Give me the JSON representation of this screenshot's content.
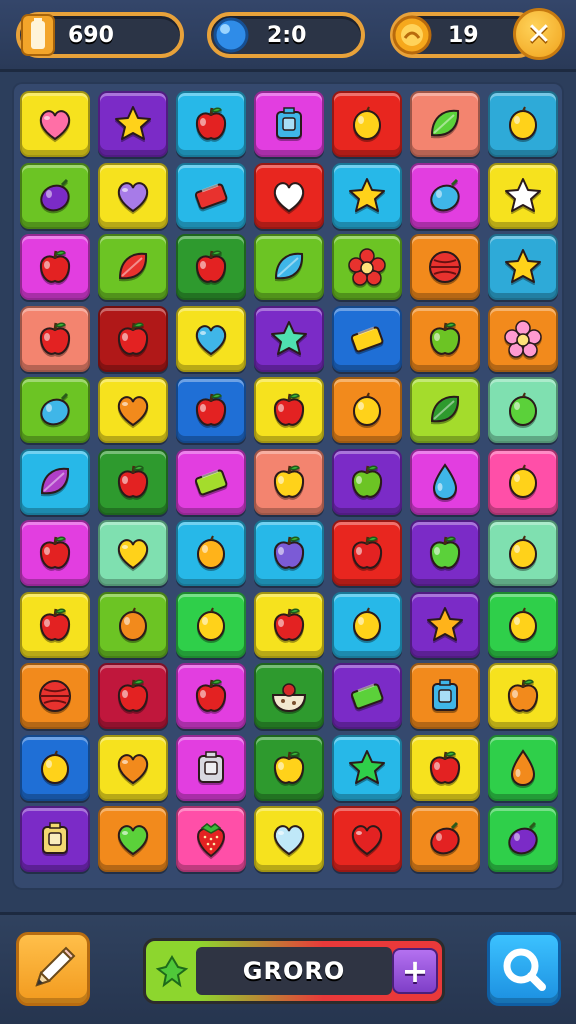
{
  "hud": {
    "score": "690",
    "timer": "2:0",
    "coins": "19",
    "score_icon": "battery-icon",
    "timer_icon": "blue-orb-icon",
    "coins_icon": "gold-coin-icon",
    "close_icon": "close-icon",
    "close_glyph": "✕"
  },
  "colors": {
    "yellow": "#f6e21e",
    "purple": "#7b2bc7",
    "cyan": "#27b8e8",
    "magenta": "#e23ee0",
    "red": "#e8261f",
    "salmon": "#f3846f",
    "teal": "#2eaad8",
    "green": "#6cc424",
    "pink": "#ff4fa8",
    "orange": "#f28a1c",
    "mint": "#7fe0b0",
    "darkgreen": "#2e9a2e",
    "blue": "#1f6fd6",
    "crimson": "#c0173c",
    "lime": "#a4dc2c",
    "darkred": "#b01818",
    "brightgreen": "#2fcf4a"
  },
  "board": {
    "rows": [
      [
        {
          "bg": "yellow",
          "icon": "heart",
          "c": "#ff6fa6"
        },
        {
          "bg": "purple",
          "icon": "star",
          "c": "#ffd21a"
        },
        {
          "bg": "cyan",
          "icon": "apple",
          "c": "#e32222"
        },
        {
          "bg": "magenta",
          "icon": "box",
          "c": "#3fb6e8"
        },
        {
          "bg": "red",
          "icon": "lemon",
          "c": "#ffd21a"
        },
        {
          "bg": "salmon",
          "icon": "leaf",
          "c": "#5bd13a"
        },
        {
          "bg": "teal",
          "icon": "lemon",
          "c": "#ffd21a"
        }
      ],
      [
        {
          "bg": "green",
          "icon": "plum",
          "c": "#7b2bc7"
        },
        {
          "bg": "yellow",
          "icon": "heart",
          "c": "#a77be8"
        },
        {
          "bg": "cyan",
          "icon": "candy",
          "c": "#e8322e"
        },
        {
          "bg": "red",
          "icon": "heart",
          "c": "#ffffff"
        },
        {
          "bg": "cyan",
          "icon": "star",
          "c": "#ffd21a"
        },
        {
          "bg": "magenta",
          "icon": "plum",
          "c": "#3fb6e8"
        },
        {
          "bg": "yellow",
          "icon": "star",
          "c": "#ffffff"
        }
      ],
      [
        {
          "bg": "magenta",
          "icon": "apple",
          "c": "#e32222"
        },
        {
          "bg": "green",
          "icon": "leaf",
          "c": "#e8322e"
        },
        {
          "bg": "darkgreen",
          "icon": "apple",
          "c": "#e32222"
        },
        {
          "bg": "green",
          "icon": "leaf",
          "c": "#3fb6e8"
        },
        {
          "bg": "green",
          "icon": "flower",
          "c": "#e8322e"
        },
        {
          "bg": "orange",
          "icon": "ball",
          "c": "#e8322e"
        },
        {
          "bg": "teal",
          "icon": "star",
          "c": "#ffd21a"
        }
      ],
      [
        {
          "bg": "salmon",
          "icon": "apple",
          "c": "#e32222"
        },
        {
          "bg": "darkred",
          "icon": "apple",
          "c": "#e32222"
        },
        {
          "bg": "yellow",
          "icon": "heart",
          "c": "#3fb6e8"
        },
        {
          "bg": "purple",
          "icon": "star",
          "c": "#4fe0b0"
        },
        {
          "bg": "blue",
          "icon": "candy",
          "c": "#ffd21a"
        },
        {
          "bg": "orange",
          "icon": "apple",
          "c": "#6cc424"
        },
        {
          "bg": "orange",
          "icon": "flower",
          "c": "#ff9ad0"
        }
      ],
      [
        {
          "bg": "green",
          "icon": "plum",
          "c": "#3fb6e8"
        },
        {
          "bg": "yellow",
          "icon": "heart",
          "c": "#f28a1c"
        },
        {
          "bg": "blue",
          "icon": "apple",
          "c": "#e32222"
        },
        {
          "bg": "yellow",
          "icon": "apple",
          "c": "#e32222"
        },
        {
          "bg": "orange",
          "icon": "lemon",
          "c": "#ffd21a"
        },
        {
          "bg": "lime",
          "icon": "leaf",
          "c": "#2e9a2e"
        },
        {
          "bg": "mint",
          "icon": "lemon",
          "c": "#5bd13a"
        }
      ],
      [
        {
          "bg": "cyan",
          "icon": "leaf",
          "c": "#b03fc8"
        },
        {
          "bg": "darkgreen",
          "icon": "apple",
          "c": "#e32222"
        },
        {
          "bg": "magenta",
          "icon": "candy",
          "c": "#a4dc2c"
        },
        {
          "bg": "salmon",
          "icon": "apple",
          "c": "#ffd21a"
        },
        {
          "bg": "purple",
          "icon": "apple",
          "c": "#6cc424"
        },
        {
          "bg": "magenta",
          "icon": "drop",
          "c": "#3fb6e8"
        },
        {
          "bg": "pink",
          "icon": "lemon",
          "c": "#ffd21a"
        }
      ],
      [
        {
          "bg": "magenta",
          "icon": "apple",
          "c": "#e32222"
        },
        {
          "bg": "mint",
          "icon": "heart",
          "c": "#ffd21a"
        },
        {
          "bg": "cyan",
          "icon": "lemon",
          "c": "#ffb31a"
        },
        {
          "bg": "cyan",
          "icon": "apple",
          "c": "#7b5bd6"
        },
        {
          "bg": "red",
          "icon": "apple",
          "c": "#e32222"
        },
        {
          "bg": "purple",
          "icon": "apple",
          "c": "#5bd13a"
        },
        {
          "bg": "mint",
          "icon": "lemon",
          "c": "#ffd21a"
        }
      ],
      [
        {
          "bg": "yellow",
          "icon": "apple",
          "c": "#e32222"
        },
        {
          "bg": "green",
          "icon": "lemon",
          "c": "#f28a1c"
        },
        {
          "bg": "brightgreen",
          "icon": "lemon",
          "c": "#ffd21a"
        },
        {
          "bg": "yellow",
          "icon": "apple",
          "c": "#e32222"
        },
        {
          "bg": "cyan",
          "icon": "lemon",
          "c": "#ffd21a"
        },
        {
          "bg": "purple",
          "icon": "star",
          "c": "#ffb31a"
        },
        {
          "bg": "brightgreen",
          "icon": "lemon",
          "c": "#ffd21a"
        }
      ],
      [
        {
          "bg": "orange",
          "icon": "ball",
          "c": "#e8322e"
        },
        {
          "bg": "crimson",
          "icon": "apple",
          "c": "#e32222"
        },
        {
          "bg": "magenta",
          "icon": "apple",
          "c": "#e32222"
        },
        {
          "bg": "darkgreen",
          "icon": "bowl",
          "c": "#f2e8d0"
        },
        {
          "bg": "purple",
          "icon": "candy",
          "c": "#5bd13a"
        },
        {
          "bg": "orange",
          "icon": "box",
          "c": "#3fb6e8"
        },
        {
          "bg": "yellow",
          "icon": "apple",
          "c": "#f28a1c"
        }
      ],
      [
        {
          "bg": "blue",
          "icon": "lemon",
          "c": "#ffd21a"
        },
        {
          "bg": "yellow",
          "icon": "heart",
          "c": "#f28a1c"
        },
        {
          "bg": "magenta",
          "icon": "box",
          "c": "#d8d8e0"
        },
        {
          "bg": "darkgreen",
          "icon": "apple",
          "c": "#ffd21a"
        },
        {
          "bg": "cyan",
          "icon": "star",
          "c": "#2fcf4a"
        },
        {
          "bg": "yellow",
          "icon": "apple",
          "c": "#e32222"
        },
        {
          "bg": "brightgreen",
          "icon": "drop",
          "c": "#f28a1c"
        }
      ],
      [
        {
          "bg": "purple",
          "icon": "box",
          "c": "#f2d870"
        },
        {
          "bg": "orange",
          "icon": "heart",
          "c": "#5bd13a"
        },
        {
          "bg": "pink",
          "icon": "strawberry",
          "c": "#e32222"
        },
        {
          "bg": "yellow",
          "icon": "heart",
          "c": "#bfe8f8"
        },
        {
          "bg": "red",
          "icon": "heart",
          "c": "#e32222"
        },
        {
          "bg": "orange",
          "icon": "plum",
          "c": "#e32222"
        },
        {
          "bg": "brightgreen",
          "icon": "plum",
          "c": "#7b2bc7"
        }
      ]
    ]
  },
  "toolbar": {
    "pencil_icon": "pencil-icon",
    "action_label": "GRORO",
    "leaf_icon": "green-leaf-icon",
    "plus_label": "+",
    "search_icon": "magnifier-icon"
  }
}
